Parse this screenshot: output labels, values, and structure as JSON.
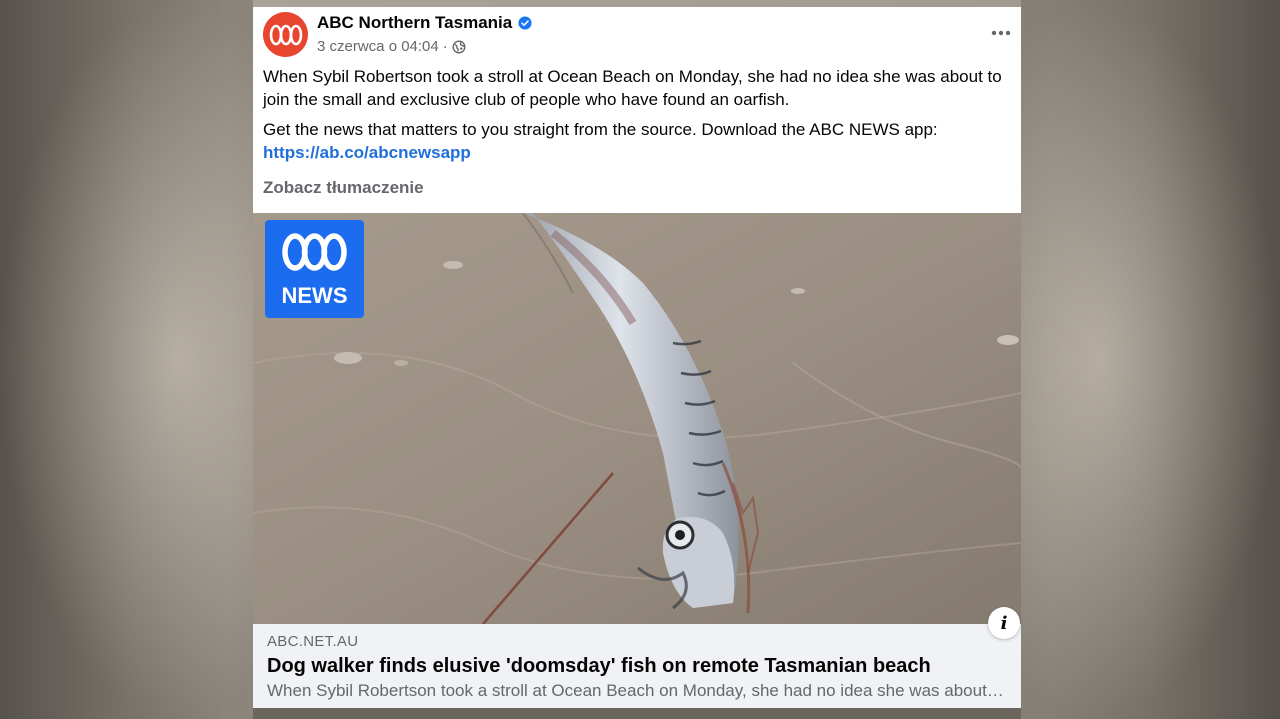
{
  "post": {
    "page_name": "ABC Northern Tasmania",
    "timestamp": "3 czerwca o 04:04",
    "separator": "·",
    "audience_icon": "globe-icon",
    "verified_icon": "verified-badge-icon",
    "more_icon": "more-dots-icon",
    "text_p1": "When Sybil Robertson took a stroll at Ocean Beach on Monday, she had no idea she was about to join the small and exclusive club of people who have found an oarfish.",
    "text_p2": "Get the news that matters to you straight from the source. Download the ABC NEWS app:",
    "link_url": "https://ab.co/abcnewsapp",
    "see_translation": "Zobacz tłumaczenie"
  },
  "media": {
    "logo_top": "ABC",
    "logo_text": "NEWS",
    "info_label": "i"
  },
  "link_preview": {
    "domain": "ABC.NET.AU",
    "title": "Dog walker finds elusive 'doomsday' fish on remote Tasmanian beach",
    "description": "When Sybil Robertson took a stroll at Ocean Beach on Monday, she had no idea she was about to join the small and exclusive club of people who have found an oarfish."
  },
  "colors": {
    "brand_red": "#e8452f",
    "abc_blue": "#1c6cf0",
    "link_blue": "#216fdb",
    "verified_blue": "#1877f2"
  }
}
